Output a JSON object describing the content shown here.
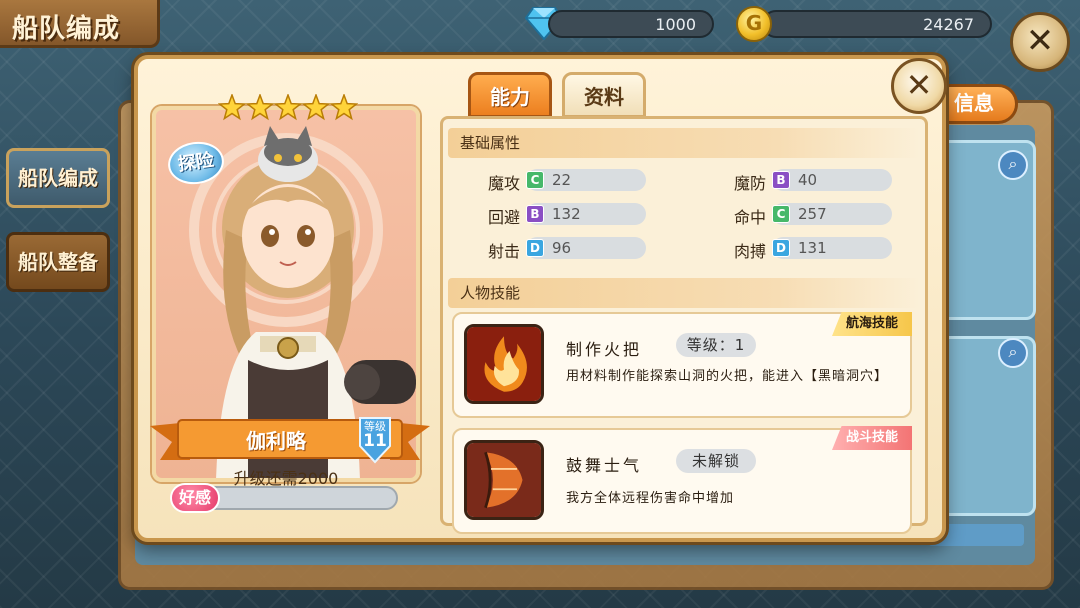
{
  "header": {
    "title": "船队编成",
    "gems": "1000",
    "coins": "24267"
  },
  "sidebar": {
    "items": [
      {
        "label": "船队编成"
      },
      {
        "label": "船队整备"
      }
    ]
  },
  "background": {
    "info_button": "信息"
  },
  "character": {
    "class_badge": "探险",
    "stars": 5,
    "name": "伽利略",
    "level_label": "等级",
    "level": "11",
    "upgrade_text": "升级还需2000",
    "affinity_label": "好感",
    "affinity_fraction": 0.1
  },
  "tabs": [
    {
      "label": "能力"
    },
    {
      "label": "资料"
    }
  ],
  "base_attributes": {
    "title": "基础属性",
    "items": [
      {
        "name": "魔攻",
        "grade": "C",
        "value": "22"
      },
      {
        "name": "魔防",
        "grade": "B",
        "value": "40"
      },
      {
        "name": "回避",
        "grade": "B",
        "value": "132"
      },
      {
        "name": "命中",
        "grade": "C",
        "value": "257"
      },
      {
        "name": "射击",
        "grade": "D",
        "value": "96"
      },
      {
        "name": "肉搏",
        "grade": "D",
        "value": "131"
      }
    ]
  },
  "skills": {
    "title": "人物技能",
    "items": [
      {
        "name": "制作火把",
        "level": "等级：1",
        "desc": "用材料制作能探索山洞的火把，能进入【黑暗洞穴】",
        "tag": "航海技能"
      },
      {
        "name": "鼓舞士气",
        "level": "未解锁",
        "desc": "我方全体远程伤害命中增加",
        "tag": "战斗技能"
      }
    ]
  }
}
